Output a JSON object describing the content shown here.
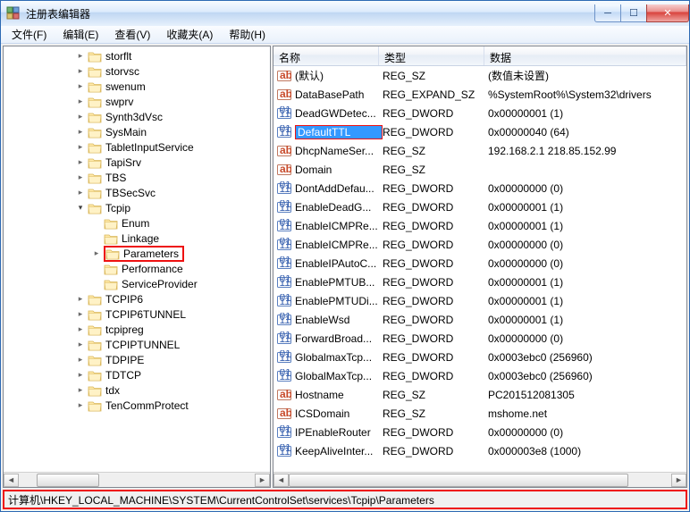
{
  "window": {
    "title": "注册表编辑器"
  },
  "menu": {
    "file": "文件(F)",
    "edit": "编辑(E)",
    "view": "查看(V)",
    "fav": "收藏夹(A)",
    "help": "帮助(H)"
  },
  "tree": {
    "items": [
      {
        "label": "storflt",
        "indent": 4,
        "exp": "closed"
      },
      {
        "label": "storvsc",
        "indent": 4,
        "exp": "closed"
      },
      {
        "label": "swenum",
        "indent": 4,
        "exp": "closed"
      },
      {
        "label": "swprv",
        "indent": 4,
        "exp": "closed"
      },
      {
        "label": "Synth3dVsc",
        "indent": 4,
        "exp": "closed"
      },
      {
        "label": "SysMain",
        "indent": 4,
        "exp": "closed"
      },
      {
        "label": "TabletInputService",
        "indent": 4,
        "exp": "closed"
      },
      {
        "label": "TapiSrv",
        "indent": 4,
        "exp": "closed"
      },
      {
        "label": "TBS",
        "indent": 4,
        "exp": "closed"
      },
      {
        "label": "TBSecSvc",
        "indent": 4,
        "exp": "closed"
      },
      {
        "label": "Tcpip",
        "indent": 4,
        "exp": "open"
      },
      {
        "label": "Enum",
        "indent": 5,
        "exp": "none"
      },
      {
        "label": "Linkage",
        "indent": 5,
        "exp": "none"
      },
      {
        "label": "Parameters",
        "indent": 5,
        "exp": "closed",
        "boxed": true
      },
      {
        "label": "Performance",
        "indent": 5,
        "exp": "none"
      },
      {
        "label": "ServiceProvider",
        "indent": 5,
        "exp": "none"
      },
      {
        "label": "TCPIP6",
        "indent": 4,
        "exp": "closed"
      },
      {
        "label": "TCPIP6TUNNEL",
        "indent": 4,
        "exp": "closed"
      },
      {
        "label": "tcpipreg",
        "indent": 4,
        "exp": "closed"
      },
      {
        "label": "TCPIPTUNNEL",
        "indent": 4,
        "exp": "closed"
      },
      {
        "label": "TDPIPE",
        "indent": 4,
        "exp": "closed"
      },
      {
        "label": "TDTCP",
        "indent": 4,
        "exp": "closed"
      },
      {
        "label": "tdx",
        "indent": 4,
        "exp": "closed"
      },
      {
        "label": "TenCommProtect",
        "indent": 4,
        "exp": "closed"
      }
    ]
  },
  "list": {
    "headers": {
      "name": "名称",
      "type": "类型",
      "data": "数据"
    },
    "rows": [
      {
        "icon": "ab",
        "name": "(默认)",
        "type": "REG_SZ",
        "data": "(数值未设置)"
      },
      {
        "icon": "ab",
        "name": "DataBasePath",
        "type": "REG_EXPAND_SZ",
        "data": "%SystemRoot%\\System32\\drivers"
      },
      {
        "icon": "num",
        "name": "DeadGWDetec...",
        "type": "REG_DWORD",
        "data": "0x00000001 (1)"
      },
      {
        "icon": "num",
        "name": "DefaultTTL",
        "type": "REG_DWORD",
        "data": "0x00000040 (64)",
        "selected": true
      },
      {
        "icon": "ab",
        "name": "DhcpNameSer...",
        "type": "REG_SZ",
        "data": "192.168.2.1 218.85.152.99"
      },
      {
        "icon": "ab",
        "name": "Domain",
        "type": "REG_SZ",
        "data": ""
      },
      {
        "icon": "num",
        "name": "DontAddDefau...",
        "type": "REG_DWORD",
        "data": "0x00000000 (0)"
      },
      {
        "icon": "num",
        "name": "EnableDeadG...",
        "type": "REG_DWORD",
        "data": "0x00000001 (1)"
      },
      {
        "icon": "num",
        "name": "EnableICMPRe...",
        "type": "REG_DWORD",
        "data": "0x00000001 (1)"
      },
      {
        "icon": "num",
        "name": "EnableICMPRe...",
        "type": "REG_DWORD",
        "data": "0x00000000 (0)"
      },
      {
        "icon": "num",
        "name": "EnableIPAutoC...",
        "type": "REG_DWORD",
        "data": "0x00000000 (0)"
      },
      {
        "icon": "num",
        "name": "EnablePMTUB...",
        "type": "REG_DWORD",
        "data": "0x00000001 (1)"
      },
      {
        "icon": "num",
        "name": "EnablePMTUDi...",
        "type": "REG_DWORD",
        "data": "0x00000001 (1)"
      },
      {
        "icon": "num",
        "name": "EnableWsd",
        "type": "REG_DWORD",
        "data": "0x00000001 (1)"
      },
      {
        "icon": "num",
        "name": "ForwardBroad...",
        "type": "REG_DWORD",
        "data": "0x00000000 (0)"
      },
      {
        "icon": "num",
        "name": "GlobalmaxTcp...",
        "type": "REG_DWORD",
        "data": "0x0003ebc0 (256960)"
      },
      {
        "icon": "num",
        "name": "GlobalMaxTcp...",
        "type": "REG_DWORD",
        "data": "0x0003ebc0 (256960)"
      },
      {
        "icon": "ab",
        "name": "Hostname",
        "type": "REG_SZ",
        "data": "PC201512081305"
      },
      {
        "icon": "ab",
        "name": "ICSDomain",
        "type": "REG_SZ",
        "data": "mshome.net"
      },
      {
        "icon": "num",
        "name": "IPEnableRouter",
        "type": "REG_DWORD",
        "data": "0x00000000 (0)"
      },
      {
        "icon": "num",
        "name": "KeepAliveInter...",
        "type": "REG_DWORD",
        "data": "0x000003e8 (1000)"
      }
    ]
  },
  "statusbar": {
    "path": "计算机\\HKEY_LOCAL_MACHINE\\SYSTEM\\CurrentControlSet\\services\\Tcpip\\Parameters"
  }
}
